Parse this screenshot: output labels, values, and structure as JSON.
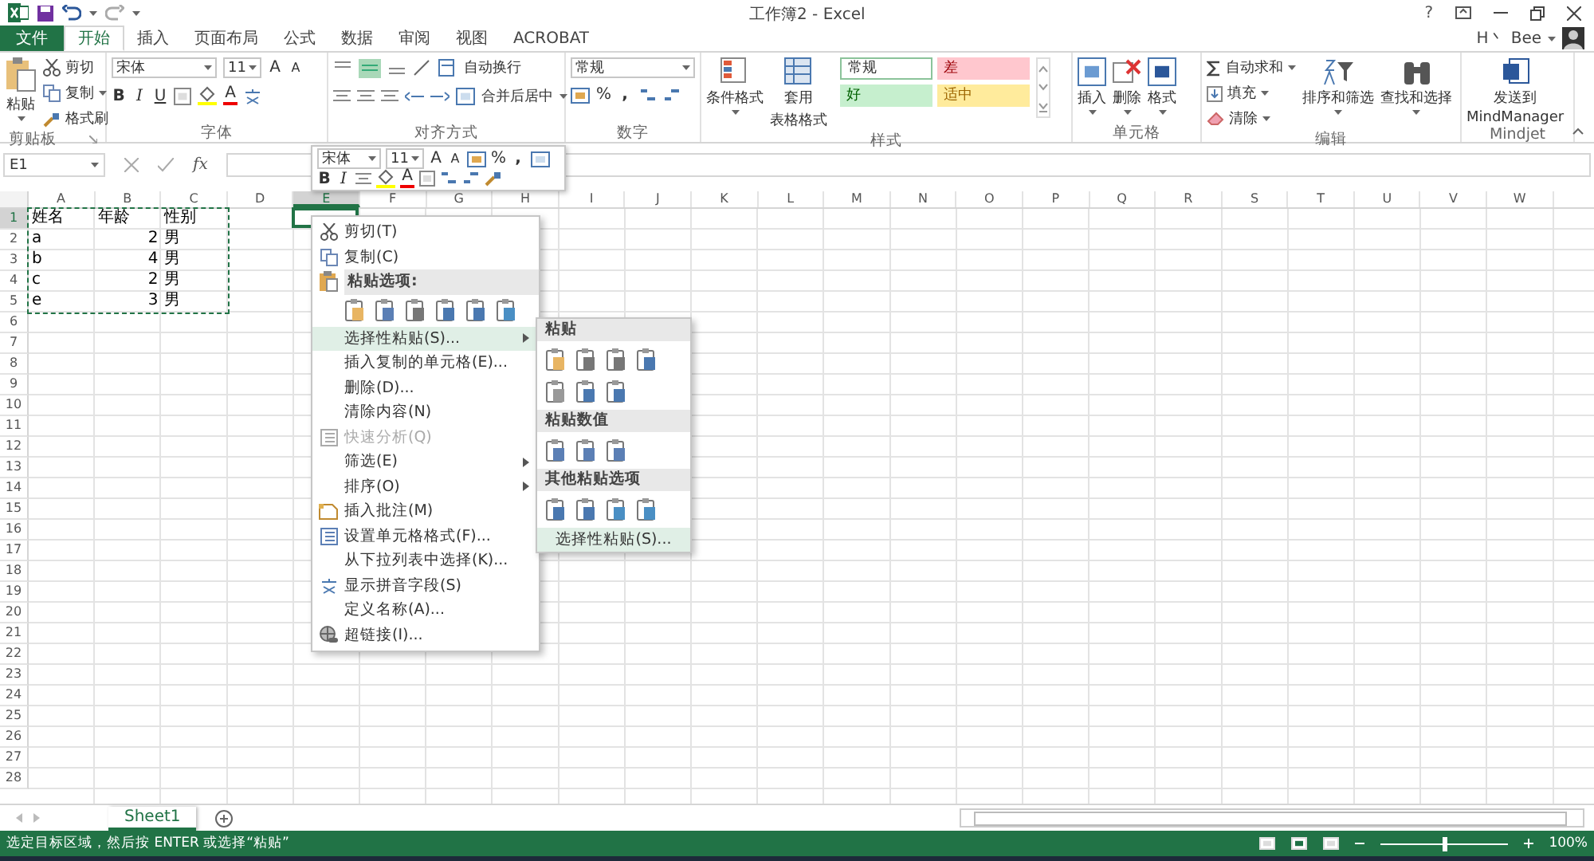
{
  "title_bar": {
    "title": "工作簿2 - Excel",
    "help": "?",
    "user_initial": "H丶",
    "user_name": "Bee"
  },
  "file_tab": "文件",
  "tabs": [
    {
      "label": "开始",
      "selected": true
    },
    {
      "label": "插入",
      "selected": false
    },
    {
      "label": "页面布局",
      "selected": false
    },
    {
      "label": "公式",
      "selected": false
    },
    {
      "label": "数据",
      "selected": false
    },
    {
      "label": "审阅",
      "selected": false
    },
    {
      "label": "视图",
      "selected": false
    },
    {
      "label": "ACROBAT",
      "selected": false
    }
  ],
  "clipboard": {
    "label": "剪贴板",
    "paste": "粘贴",
    "cut": "剪切",
    "copy": "复制",
    "format_painter": "格式刷"
  },
  "font": {
    "label": "字体",
    "font_name": "宋体",
    "font_size": "11",
    "grow": "A",
    "shrink": "A",
    "bold": "B",
    "italic": "I",
    "underline": "U",
    "color_letter": "A"
  },
  "alignment": {
    "label": "对齐方式",
    "wrap": "自动换行",
    "merge": "合并后居中"
  },
  "number": {
    "label": "数字",
    "format": "常规",
    "percent": "%",
    "comma": ","
  },
  "styles": {
    "label": "样式",
    "conditional": "条件格式",
    "table_lines": [
      "套用",
      "表格格式"
    ],
    "cell_styles": [
      {
        "label": "常规",
        "color": "#ffffff"
      },
      {
        "label": "差",
        "color": "#ffc7ce"
      },
      {
        "label": "好",
        "color": "#c6efce"
      },
      {
        "label": "适中",
        "color": "#ffeb9c"
      }
    ]
  },
  "cells": {
    "label": "单元格",
    "insert": "插入",
    "delete": "删除",
    "format": "格式"
  },
  "editing": {
    "label": "编辑",
    "autosum": "自动求和",
    "fill": "填充",
    "clear": "清除",
    "sort": "排序和筛选",
    "find": "查找和选择"
  },
  "mindjet": {
    "label": "Mindjet",
    "lines": [
      "发送到",
      "MindManager"
    ]
  },
  "formula_bar": {
    "name_box": "E1",
    "function": "fx"
  },
  "mini_toolbar": {
    "font_name": "宋体",
    "font_size": "11",
    "grow": "A",
    "shrink": "A",
    "percent": "%",
    "comma": ",",
    "bold": "B",
    "italic": "I",
    "color_letter": "A"
  },
  "columns": [
    {
      "label": "A",
      "selected": false
    },
    {
      "label": "B",
      "selected": false
    },
    {
      "label": "C",
      "selected": false
    },
    {
      "label": "D",
      "selected": false
    },
    {
      "label": "E",
      "selected": true
    },
    {
      "label": "F",
      "selected": false
    },
    {
      "label": "G",
      "selected": false
    },
    {
      "label": "H",
      "selected": false
    },
    {
      "label": "I",
      "selected": false
    },
    {
      "label": "J",
      "selected": false
    },
    {
      "label": "K",
      "selected": false
    },
    {
      "label": "L",
      "selected": false
    },
    {
      "label": "M",
      "selected": false
    },
    {
      "label": "N",
      "selected": false
    },
    {
      "label": "O",
      "selected": false
    },
    {
      "label": "P",
      "selected": false
    },
    {
      "label": "Q",
      "selected": false
    },
    {
      "label": "R",
      "selected": false
    },
    {
      "label": "S",
      "selected": false
    },
    {
      "label": "T",
      "selected": false
    },
    {
      "label": "U",
      "selected": false
    },
    {
      "label": "V",
      "selected": false
    },
    {
      "label": "W",
      "selected": false
    }
  ],
  "rows": [
    {
      "label": "1",
      "selected": true,
      "cells": [
        {
          "text": "姓名",
          "kind": "text"
        },
        {
          "text": "年龄",
          "kind": "text"
        },
        {
          "text": "性别",
          "kind": "text"
        }
      ]
    },
    {
      "label": "2",
      "selected": false,
      "cells": [
        {
          "text": "a",
          "kind": "text"
        },
        {
          "text": "2",
          "kind": "number"
        },
        {
          "text": "男",
          "kind": "text"
        }
      ]
    },
    {
      "label": "3",
      "selected": false,
      "cells": [
        {
          "text": "b",
          "kind": "text"
        },
        {
          "text": "4",
          "kind": "number"
        },
        {
          "text": "男",
          "kind": "text"
        }
      ]
    },
    {
      "label": "4",
      "selected": false,
      "cells": [
        {
          "text": "c",
          "kind": "text"
        },
        {
          "text": "2",
          "kind": "number"
        },
        {
          "text": "男",
          "kind": "text"
        }
      ]
    },
    {
      "label": "5",
      "selected": false,
      "cells": [
        {
          "text": "e",
          "kind": "text"
        },
        {
          "text": "3",
          "kind": "number"
        },
        {
          "text": "男",
          "kind": "text"
        }
      ]
    },
    {
      "label": "6",
      "selected": false
    },
    {
      "label": "7",
      "selected": false
    },
    {
      "label": "8",
      "selected": false
    },
    {
      "label": "9",
      "selected": false
    },
    {
      "label": "10",
      "selected": false
    },
    {
      "label": "11",
      "selected": false
    },
    {
      "label": "12",
      "selected": false
    },
    {
      "label": "13",
      "selected": false
    },
    {
      "label": "14",
      "selected": false
    },
    {
      "label": "15",
      "selected": false
    },
    {
      "label": "16",
      "selected": false
    },
    {
      "label": "17",
      "selected": false
    },
    {
      "label": "18",
      "selected": false
    },
    {
      "label": "19",
      "selected": false
    },
    {
      "label": "20",
      "selected": false
    },
    {
      "label": "21",
      "selected": false
    },
    {
      "label": "22",
      "selected": false
    },
    {
      "label": "23",
      "selected": false
    },
    {
      "label": "24",
      "selected": false
    },
    {
      "label": "25",
      "selected": false
    },
    {
      "label": "26",
      "selected": false
    },
    {
      "label": "27",
      "selected": false
    },
    {
      "label": "28",
      "selected": false
    }
  ],
  "context_menu": [
    {
      "kind": "item",
      "label": "剪切(T)",
      "selected": false,
      "disabled": false,
      "submenu": false
    },
    {
      "kind": "item",
      "label": "复制(C)",
      "selected": false,
      "disabled": false,
      "submenu": false
    },
    {
      "kind": "header",
      "label": "粘贴选项:"
    },
    {
      "kind": "icons"
    },
    {
      "kind": "item",
      "label": "选择性粘贴(S)...",
      "selected": true,
      "disabled": false,
      "submenu": true
    },
    {
      "kind": "item",
      "label": "插入复制的单元格(E)...",
      "selected": false,
      "disabled": false,
      "submenu": false
    },
    {
      "kind": "item",
      "label": "删除(D)...",
      "selected": false,
      "disabled": false,
      "submenu": false
    },
    {
      "kind": "item",
      "label": "清除内容(N)",
      "selected": false,
      "disabled": false,
      "submenu": false
    },
    {
      "kind": "item",
      "label": "快速分析(Q)",
      "selected": false,
      "disabled": true,
      "submenu": false
    },
    {
      "kind": "item",
      "label": "筛选(E)",
      "selected": false,
      "disabled": false,
      "submenu": true
    },
    {
      "kind": "item",
      "label": "排序(O)",
      "selected": false,
      "disabled": false,
      "submenu": true
    },
    {
      "kind": "item",
      "label": "插入批注(M)",
      "selected": false,
      "disabled": false,
      "submenu": false
    },
    {
      "kind": "item",
      "label": "设置单元格格式(F)...",
      "selected": false,
      "disabled": false,
      "submenu": false
    },
    {
      "kind": "item",
      "label": "从下拉列表中选择(K)...",
      "selected": false,
      "disabled": false,
      "submenu": false
    },
    {
      "kind": "item",
      "label": "显示拼音字段(S)",
      "selected": false,
      "disabled": false,
      "submenu": false
    },
    {
      "kind": "item",
      "label": "定义名称(A)...",
      "selected": false,
      "disabled": false,
      "submenu": false
    },
    {
      "kind": "item",
      "label": "超链接(I)...",
      "selected": false,
      "disabled": false,
      "submenu": false
    }
  ],
  "submenu": [
    {
      "kind": "header",
      "label": "粘贴"
    },
    {
      "kind": "icons"
    },
    {
      "kind": "header",
      "label": "粘贴数值"
    },
    {
      "kind": "icons"
    },
    {
      "kind": "header",
      "label": "其他粘贴选项"
    },
    {
      "kind": "icons"
    },
    {
      "kind": "item",
      "label": "选择性粘贴(S)...",
      "selected": true
    }
  ],
  "sheet_tabs": [
    {
      "label": "Sheet1",
      "selected": true
    }
  ],
  "status_bar": {
    "message": "选定目标区域，然后按 ENTER 或选择“粘贴”",
    "zoom": "100%",
    "zoom_level": {
      "level": 0.5
    }
  }
}
